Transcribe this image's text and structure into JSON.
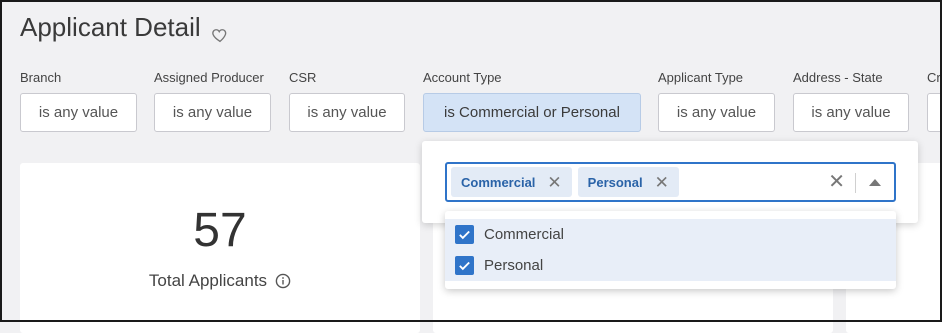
{
  "page": {
    "title": "Applicant Detail",
    "favorite_icon": "heart-outline-icon"
  },
  "filters": [
    {
      "label": "Branch",
      "value": "is any value"
    },
    {
      "label": "Assigned Producer",
      "value": "is any value"
    },
    {
      "label": "CSR",
      "value": "is any value"
    },
    {
      "label": "Account Type",
      "value": "is Commercial or Personal"
    },
    {
      "label": "Applicant Type",
      "value": "is any value"
    },
    {
      "label": "Address - State",
      "value": "is any value"
    },
    {
      "label": "Cr",
      "value": ""
    }
  ],
  "kpi": {
    "value": "57",
    "caption": "Total Applicants",
    "info_icon": "info-circle-icon"
  },
  "account_type_popover": {
    "chips": [
      {
        "label": "Commercial"
      },
      {
        "label": "Personal"
      }
    ],
    "options": [
      {
        "label": "Commercial",
        "checked": true
      },
      {
        "label": "Personal",
        "checked": true
      }
    ]
  },
  "colors": {
    "accent": "#2f74c9",
    "chip_bg": "#e3ebf6",
    "active_filter_bg": "#d4e3f6",
    "page_bg": "#f1f1f3"
  }
}
